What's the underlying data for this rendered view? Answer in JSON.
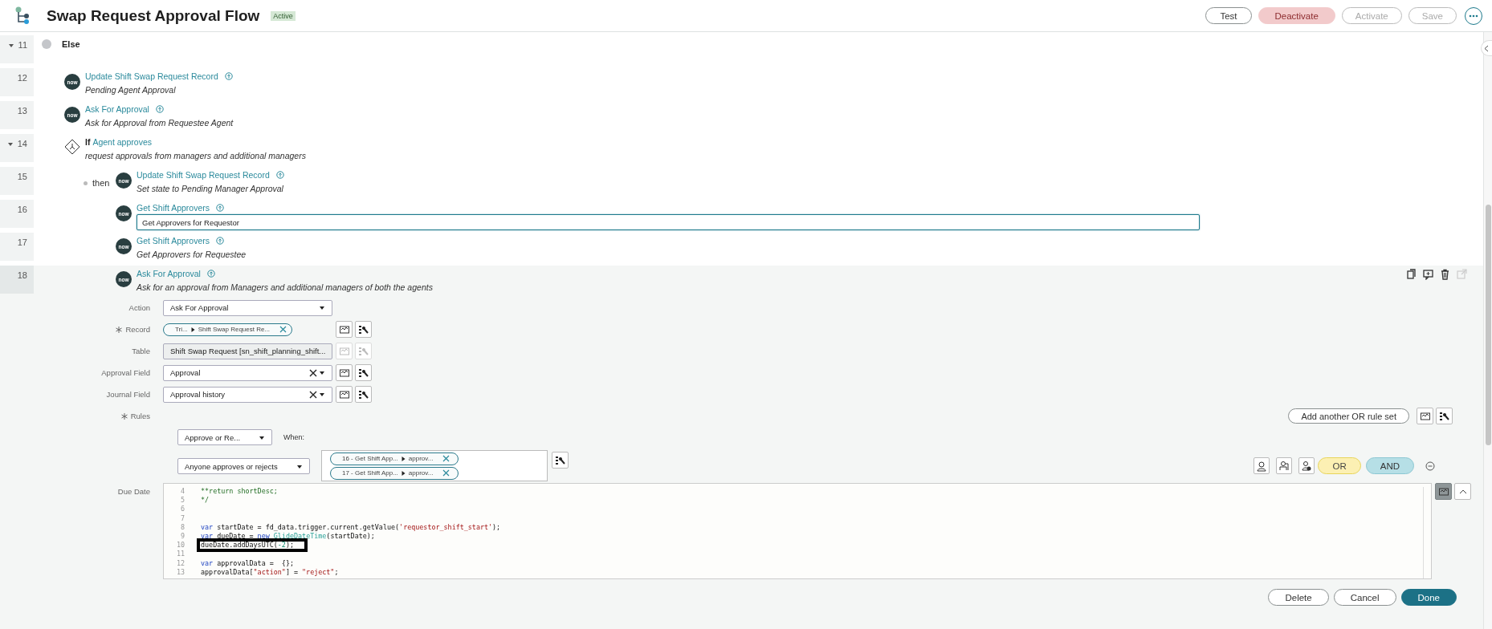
{
  "header": {
    "title": "Swap Request Approval Flow",
    "badge": "Active",
    "buttons": [
      {
        "label": "Test",
        "kind": "default"
      },
      {
        "label": "Deactivate",
        "kind": "danger"
      },
      {
        "label": "Activate",
        "kind": "disabled"
      },
      {
        "label": "Save",
        "kind": "disabled"
      }
    ]
  },
  "steps": [
    {
      "line": "11",
      "kind": "else",
      "expanded": true,
      "selected": false,
      "label": "Else",
      "children": [
        {
          "line": "12",
          "kind": "action",
          "selected": false,
          "editing": false,
          "icon_text": "now",
          "title": "Update Shift Swap Request Record",
          "description": "Pending Agent Approval"
        },
        {
          "line": "13",
          "kind": "action",
          "selected": false,
          "editing": false,
          "icon_text": "now",
          "title": "Ask For Approval",
          "description": "Ask for Approval from Requestee Agent"
        },
        {
          "line": "14",
          "kind": "if",
          "expanded": true,
          "selected": false,
          "keyword": "If",
          "title": "Agent approves",
          "description": "request approvals from managers and additional managers",
          "branch": "then",
          "children": [
            {
              "line": "15",
              "kind": "action",
              "selected": false,
              "editing": false,
              "icon_text": "now",
              "title": "Update Shift Swap Request Record",
              "description": "Set state to Pending Manager Approval"
            },
            {
              "line": "16",
              "kind": "action",
              "selected": false,
              "editing": true,
              "icon_text": "now",
              "title": "Get Shift Approvers",
              "description": "Get Approvers for Requestor"
            },
            {
              "line": "17",
              "kind": "action",
              "selected": false,
              "editing": false,
              "icon_text": "now",
              "title": "Get Shift Approvers",
              "description": "Get Approvers for Requestee"
            },
            {
              "line": "18",
              "kind": "action",
              "selected": true,
              "editing": false,
              "icon_text": "now",
              "title": "Ask For Approval",
              "description": "Ask for an approval from Managers and additional managers of both the agents"
            }
          ]
        }
      ]
    }
  ],
  "editor": {
    "row_actions": [
      {
        "kind": "copy",
        "disabled": false
      },
      {
        "kind": "comment",
        "disabled": false
      },
      {
        "kind": "delete",
        "disabled": false
      },
      {
        "kind": "open",
        "disabled": true
      }
    ],
    "fields": [
      {
        "kind": "select",
        "label": "Action",
        "required": false,
        "disabled": false,
        "tools": false,
        "value": "Ask For Approval"
      },
      {
        "kind": "pill",
        "label": "Record",
        "required": true,
        "disabled": false,
        "tools": true,
        "pills": [
          {
            "parts": [
              "Tri...",
              "Shift Swap Request Re..."
            ]
          }
        ]
      },
      {
        "kind": "select",
        "label": "Table",
        "required": false,
        "disabled": true,
        "tools": true,
        "value": "Shift Swap Request [sn_shift_planning_shift..."
      },
      {
        "kind": "clearable",
        "label": "Approval Field",
        "required": false,
        "disabled": false,
        "tools": true,
        "value": "Approval"
      },
      {
        "kind": "clearable",
        "label": "Journal Field",
        "required": false,
        "disabled": false,
        "tools": true,
        "value": "Approval history"
      }
    ],
    "rules": {
      "label": "Rules",
      "required": true,
      "add_button": "Add another OR rule set",
      "rule_sets": [
        {
          "mode": "Approve or Re...",
          "when_label": "When:",
          "condition": "Anyone approves or rejects",
          "pills": [
            {
              "parts": [
                "16 - Get Shift App...",
                "approv..."
              ]
            },
            {
              "parts": [
                "17 - Get Shift App...",
                "approv..."
              ]
            }
          ],
          "or_label": "OR",
          "and_label": "AND"
        }
      ]
    },
    "due_date": {
      "label": "Due Date",
      "script_active": true,
      "lines": [
        {
          "num": "4",
          "kind": "comment",
          "text": "**return shortDesc;"
        },
        {
          "num": "5",
          "kind": "comment",
          "text": "*/"
        },
        {
          "num": "6"
        },
        {
          "num": "7"
        },
        {
          "num": "8",
          "kind": "code",
          "text": "var startDate = fd_data.trigger.current.getValue('requestor_shift_start');"
        },
        {
          "num": "9",
          "kind": "code",
          "text": "var dueDate = new GlideDateTime(startDate);"
        },
        {
          "num": "10",
          "kind": "code",
          "highlighted": true,
          "text": "dueDate.addDaysUTC(-2);"
        },
        {
          "num": "11"
        },
        {
          "num": "12",
          "kind": "code",
          "text": "var approvalData =  {};"
        },
        {
          "num": "13",
          "kind": "code",
          "text": "approvalData[\"action\"] = \"reject\";"
        }
      ]
    }
  },
  "footer": {
    "buttons": [
      {
        "label": "Delete",
        "kind": "default"
      },
      {
        "label": "Cancel",
        "kind": "default"
      },
      {
        "label": "Done",
        "kind": "primary"
      }
    ]
  }
}
